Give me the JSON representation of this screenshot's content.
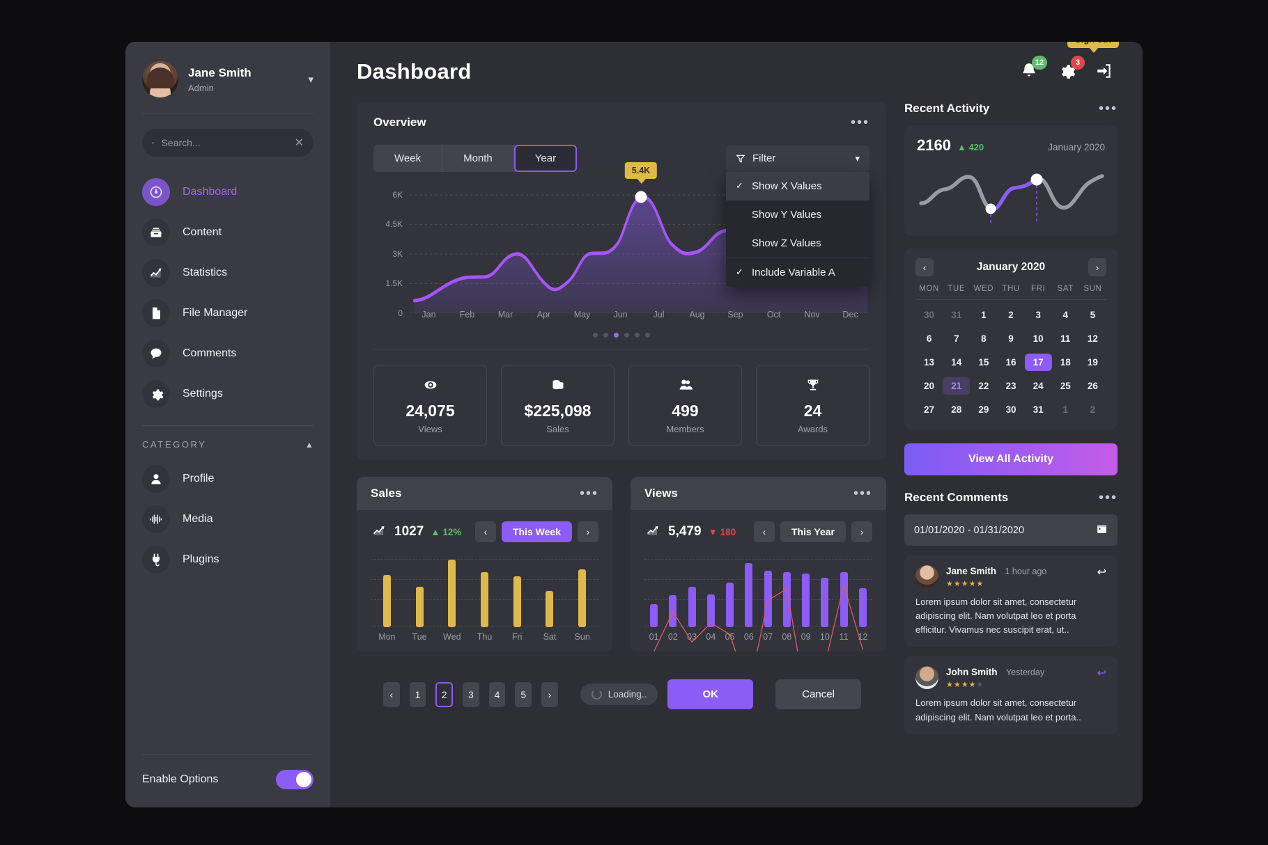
{
  "sidebar": {
    "user": {
      "name": "Jane Smith",
      "role": "Admin"
    },
    "search": {
      "placeholder": "Search...",
      "value": ""
    },
    "nav": [
      {
        "label": "Dashboard",
        "icon": "speedometer-icon"
      },
      {
        "label": "Content",
        "icon": "archive-icon"
      },
      {
        "label": "Statistics",
        "icon": "chart-line-icon"
      },
      {
        "label": "File Manager",
        "icon": "file-icon"
      },
      {
        "label": "Comments",
        "icon": "comment-icon"
      },
      {
        "label": "Settings",
        "icon": "gear-icon"
      }
    ],
    "category_label": "CATEGORY",
    "category_items": [
      {
        "label": "Profile",
        "icon": "user-icon"
      },
      {
        "label": "Media",
        "icon": "waveform-icon"
      },
      {
        "label": "Plugins",
        "icon": "plug-icon"
      }
    ],
    "footer": {
      "toggle_label": "Enable Options",
      "toggle_on": true
    }
  },
  "header": {
    "title": "Dashboard",
    "notifications_badge": "12",
    "settings_badge": "3",
    "signout_tooltip": "Sign out"
  },
  "overview": {
    "title": "Overview",
    "segments": [
      "Week",
      "Month",
      "Year"
    ],
    "selected_segment": "Year",
    "filter_label": "Filter",
    "dropdown": [
      {
        "label": "Show X Values",
        "checked": true,
        "highlighted": true
      },
      {
        "label": "Show Y Values",
        "checked": false,
        "highlighted": false
      },
      {
        "label": "Show Z Values",
        "checked": false,
        "highlighted": false
      },
      {
        "label": "Include Variable A",
        "checked": true,
        "highlighted": false
      }
    ],
    "tooltip_value": "5.4K",
    "carousel_dots": 6,
    "carousel_active": 3,
    "stats": [
      {
        "value": "24,075",
        "label": "Views",
        "icon": "eye-icon"
      },
      {
        "value": "$225,098",
        "label": "Sales",
        "icon": "coins-icon"
      },
      {
        "value": "499",
        "label": "Members",
        "icon": "users-icon"
      },
      {
        "value": "24",
        "label": "Awards",
        "icon": "trophy-icon"
      }
    ]
  },
  "chart_data": {
    "type": "area",
    "title": "Overview",
    "xlabel": "",
    "ylabel": "",
    "categories": [
      "Jan",
      "Feb",
      "Mar",
      "Apr",
      "May",
      "Jun",
      "Jul",
      "Aug",
      "Sep",
      "Oct",
      "Nov",
      "Dec"
    ],
    "values": [
      600,
      1450,
      2300,
      1350,
      2700,
      5400,
      3200,
      4100,
      2900,
      3900,
      2200,
      4600
    ],
    "yticks": [
      "0",
      "1.5K",
      "3K",
      "4.5K",
      "6K"
    ],
    "ylim": [
      0,
      6000
    ],
    "grid": true,
    "highlight": {
      "category": "Jun",
      "value": 5400,
      "label": "5.4K"
    },
    "line_color": "#a855f7",
    "fill_color": "rgba(138,92,246,0.28)"
  },
  "sales_card": {
    "title": "Sales",
    "value": "1027",
    "delta": "12%",
    "delta_dir": "up",
    "range_label": "This Week",
    "chart_data": {
      "type": "bar",
      "categories": [
        "Mon",
        "Tue",
        "Wed",
        "Thu",
        "Fri",
        "Sat",
        "Sun"
      ],
      "values": [
        72,
        56,
        93,
        76,
        70,
        50,
        80
      ],
      "ylim": [
        0,
        100
      ],
      "bar_color": "#e0b94b"
    }
  },
  "views_card": {
    "title": "Views",
    "value": "5,479",
    "delta": "180",
    "delta_dir": "down",
    "range_label": "This Year",
    "chart_data": {
      "type": "bar",
      "categories": [
        "01",
        "02",
        "03",
        "04",
        "05",
        "06",
        "07",
        "08",
        "09",
        "10",
        "11",
        "12"
      ],
      "series": [
        {
          "name": "bars",
          "type": "bar",
          "values": [
            32,
            44,
            56,
            45,
            62,
            88,
            78,
            76,
            74,
            68,
            76,
            54
          ],
          "color": "#8b5cf6"
        },
        {
          "name": "line",
          "type": "line",
          "values": [
            49,
            70,
            54,
            64,
            58,
            28,
            76,
            82,
            24,
            42,
            84,
            50
          ],
          "color": "#e05a5f"
        }
      ],
      "ylim": [
        0,
        100
      ]
    }
  },
  "pagination": {
    "prev": "‹",
    "pages": [
      "1",
      "2",
      "3",
      "4",
      "5"
    ],
    "current": "2",
    "next": "›",
    "loading_label": "Loading..",
    "ok_label": "OK",
    "cancel_label": "Cancel"
  },
  "recent_activity": {
    "title": "Recent Activity",
    "value": "2160",
    "delta": "420",
    "month": "January 2020",
    "chart_data": {
      "type": "line",
      "series": [
        {
          "name": "activity",
          "values": [
            30,
            36,
            58,
            62,
            60,
            20,
            42,
            45,
            66,
            70,
            26,
            22,
            52,
            62
          ]
        }
      ],
      "markers": [
        {
          "x": 5,
          "y": 20
        },
        {
          "x": 9,
          "y": 70
        }
      ],
      "line_color": "#9a9aa3",
      "highlight_color": "#8b5cf6"
    },
    "view_all_label": "View All Activity"
  },
  "calendar": {
    "month": "January 2020",
    "prev_icon": "chevron-left-icon",
    "next_icon": "chevron-right-icon",
    "dow": [
      "MON",
      "TUE",
      "WED",
      "THU",
      "FRI",
      "SAT",
      "SUN"
    ],
    "weeks": [
      [
        {
          "d": "30",
          "s": "mut"
        },
        {
          "d": "31",
          "s": "mut"
        },
        {
          "d": "1"
        },
        {
          "d": "2"
        },
        {
          "d": "3"
        },
        {
          "d": "4"
        },
        {
          "d": "5"
        }
      ],
      [
        {
          "d": "6"
        },
        {
          "d": "7"
        },
        {
          "d": "8"
        },
        {
          "d": "9"
        },
        {
          "d": "10"
        },
        {
          "d": "11"
        },
        {
          "d": "12"
        }
      ],
      [
        {
          "d": "13"
        },
        {
          "d": "14"
        },
        {
          "d": "15"
        },
        {
          "d": "16"
        },
        {
          "d": "17",
          "s": "sel"
        },
        {
          "d": "18"
        },
        {
          "d": "19"
        }
      ],
      [
        {
          "d": "20"
        },
        {
          "d": "21",
          "s": "sel2"
        },
        {
          "d": "22"
        },
        {
          "d": "23"
        },
        {
          "d": "24"
        },
        {
          "d": "25"
        },
        {
          "d": "26"
        }
      ],
      [
        {
          "d": "27"
        },
        {
          "d": "28"
        },
        {
          "d": "29"
        },
        {
          "d": "30"
        },
        {
          "d": "31"
        },
        {
          "d": "1",
          "s": "mut"
        },
        {
          "d": "2",
          "s": "mut"
        }
      ]
    ]
  },
  "recent_comments": {
    "title": "Recent Comments",
    "date_range": "01/01/2020 - 01/31/2020",
    "items": [
      {
        "name": "Jane Smith",
        "time": "1 hour ago",
        "stars": 5,
        "text": "Lorem ipsum dolor sit amet, consectetur adipiscing elit. Nam volutpat leo et porta efficitur. Vivamus nec suscipit erat, ut..",
        "avatar": "f",
        "reply_active": false
      },
      {
        "name": "John Smith",
        "time": "Yesterday",
        "stars": 4,
        "text": "Lorem ipsum dolor sit amet, consectetur adipiscing elit. Nam volutpat leo et porta..",
        "avatar": "m",
        "reply_active": true
      }
    ]
  }
}
